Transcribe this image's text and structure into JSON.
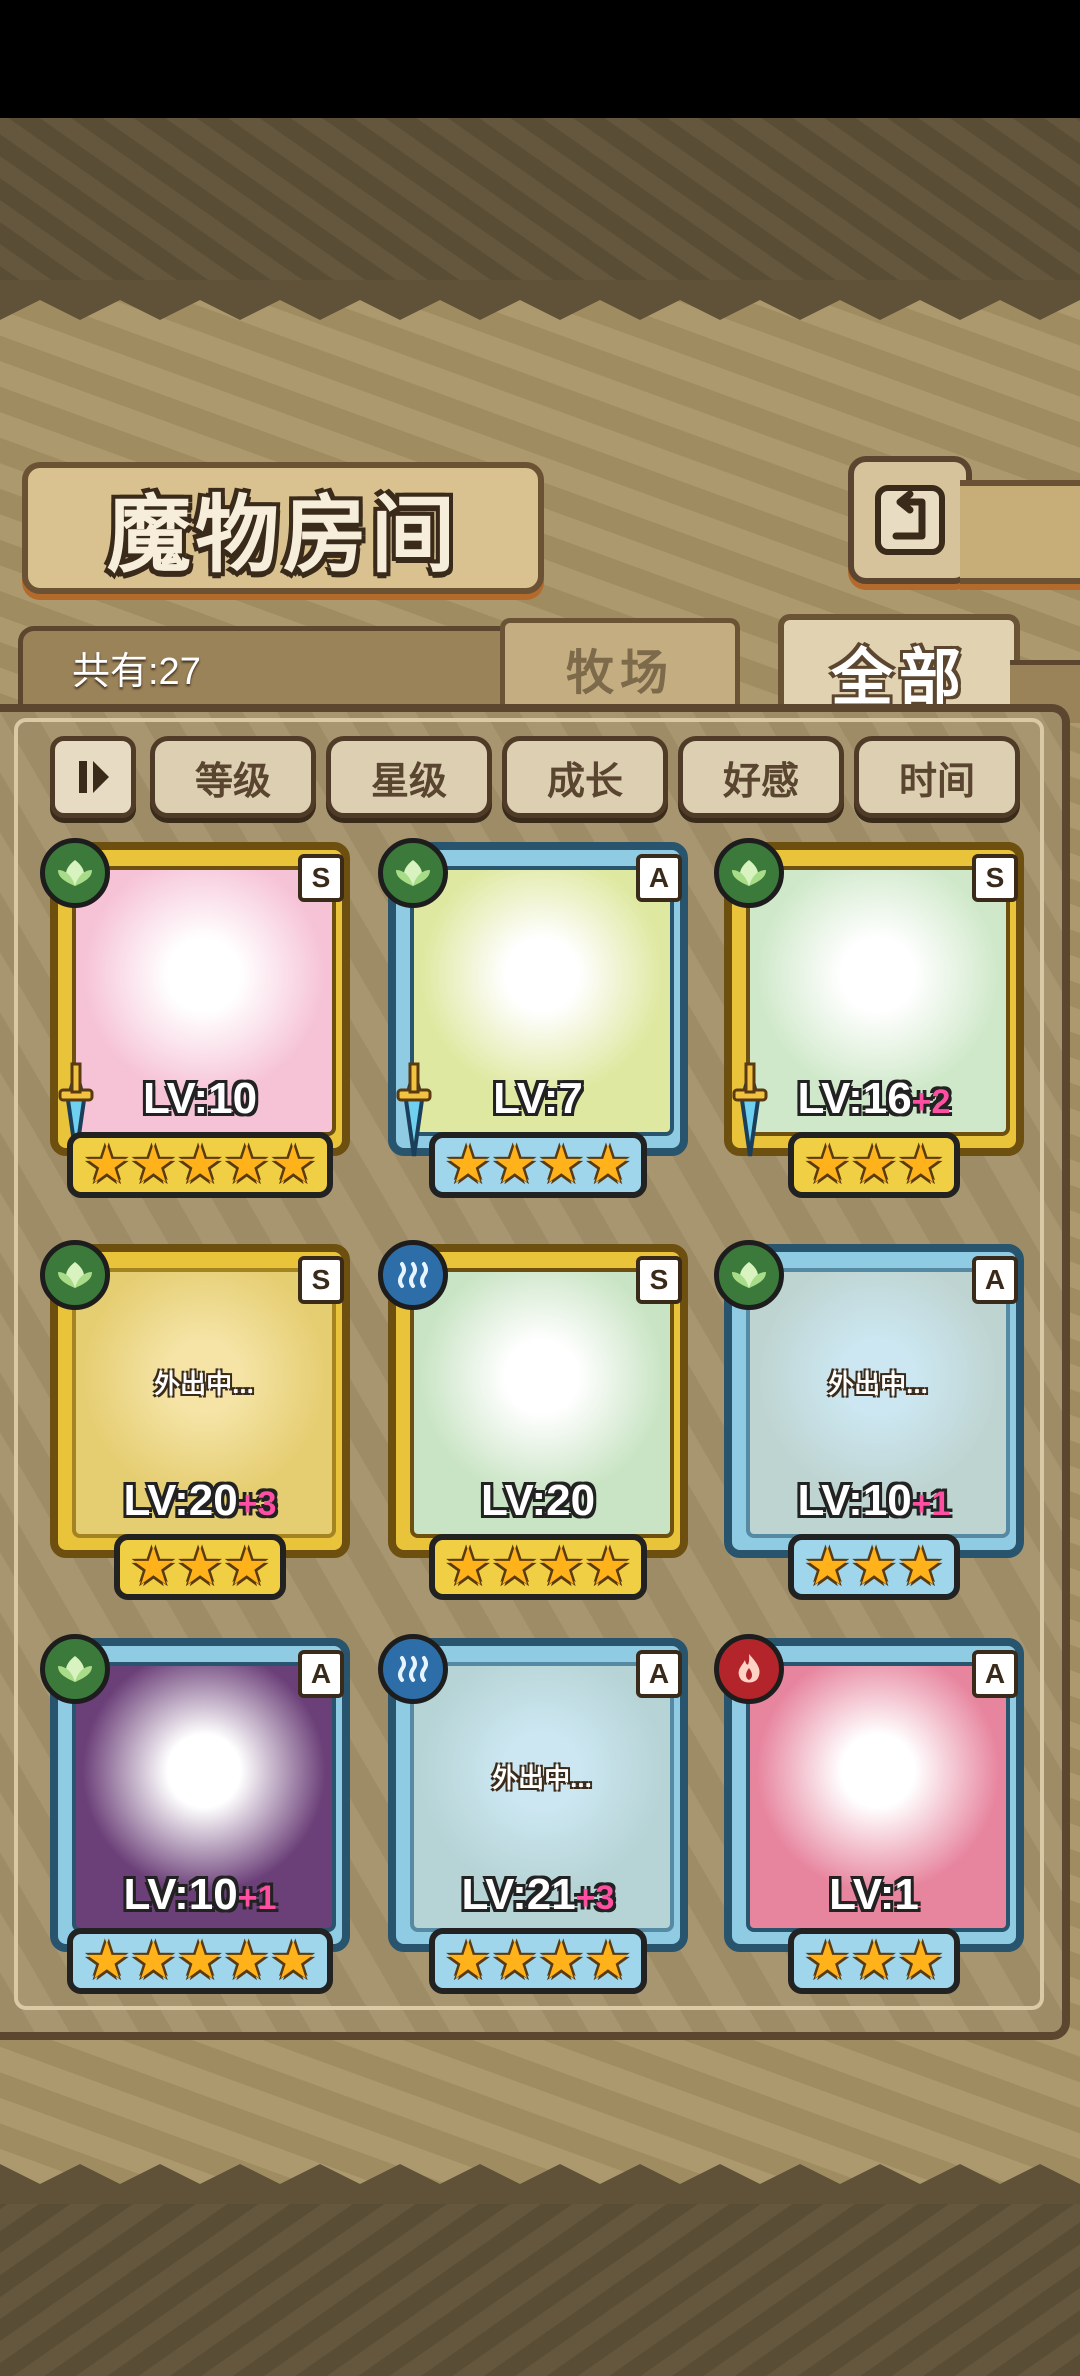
{
  "header": {
    "title": "魔物房间",
    "total_label": "共有:27"
  },
  "tabs": [
    {
      "label": "牧场",
      "active": false
    },
    {
      "label": "全部",
      "active": true
    }
  ],
  "sort_buttons": [
    "等级",
    "星级",
    "成长",
    "好感",
    "时间"
  ],
  "cards": [
    {
      "rank": "S",
      "element": "grass",
      "frame": "gold",
      "level": "LV:10",
      "bonus": "",
      "stars": 5,
      "away": "",
      "equipped": true,
      "portrait_color": "#f6c2d6"
    },
    {
      "rank": "A",
      "element": "grass",
      "frame": "blue",
      "level": "LV:7",
      "bonus": "",
      "stars": 4,
      "away": "",
      "equipped": true,
      "portrait_color": "#dfe8a0"
    },
    {
      "rank": "S",
      "element": "grass",
      "frame": "gold",
      "level": "LV:16",
      "bonus": "+2",
      "stars": 3,
      "away": "",
      "equipped": true,
      "portrait_color": "#cfe8c9"
    },
    {
      "rank": "S",
      "element": "grass",
      "frame": "gold",
      "level": "LV:20",
      "bonus": "+3",
      "stars": 3,
      "away": "外出中...",
      "equipped": false,
      "portrait_color": "#e3d6a0"
    },
    {
      "rank": "S",
      "element": "water",
      "frame": "gold",
      "level": "LV:20",
      "bonus": "",
      "stars": 4,
      "away": "",
      "equipped": false,
      "portrait_color": "#c9e4c4"
    },
    {
      "rank": "A",
      "element": "grass",
      "frame": "blue",
      "level": "LV:10",
      "bonus": "+1",
      "stars": 3,
      "away": "外出中...",
      "equipped": false,
      "portrait_color": "#e6dcc4"
    },
    {
      "rank": "A",
      "element": "grass",
      "frame": "blue",
      "level": "LV:10",
      "bonus": "+1",
      "stars": 5,
      "away": "",
      "equipped": false,
      "portrait_color": "#6b3f78"
    },
    {
      "rank": "A",
      "element": "water",
      "frame": "blue",
      "level": "LV:21",
      "bonus": "+3",
      "stars": 4,
      "away": "外出中...",
      "equipped": false,
      "portrait_color": "#d7dccd"
    },
    {
      "rank": "A",
      "element": "fire",
      "frame": "blue",
      "level": "LV:1",
      "bonus": "",
      "stars": 3,
      "away": "",
      "equipped": false,
      "portrait_color": "#e7849e"
    }
  ]
}
